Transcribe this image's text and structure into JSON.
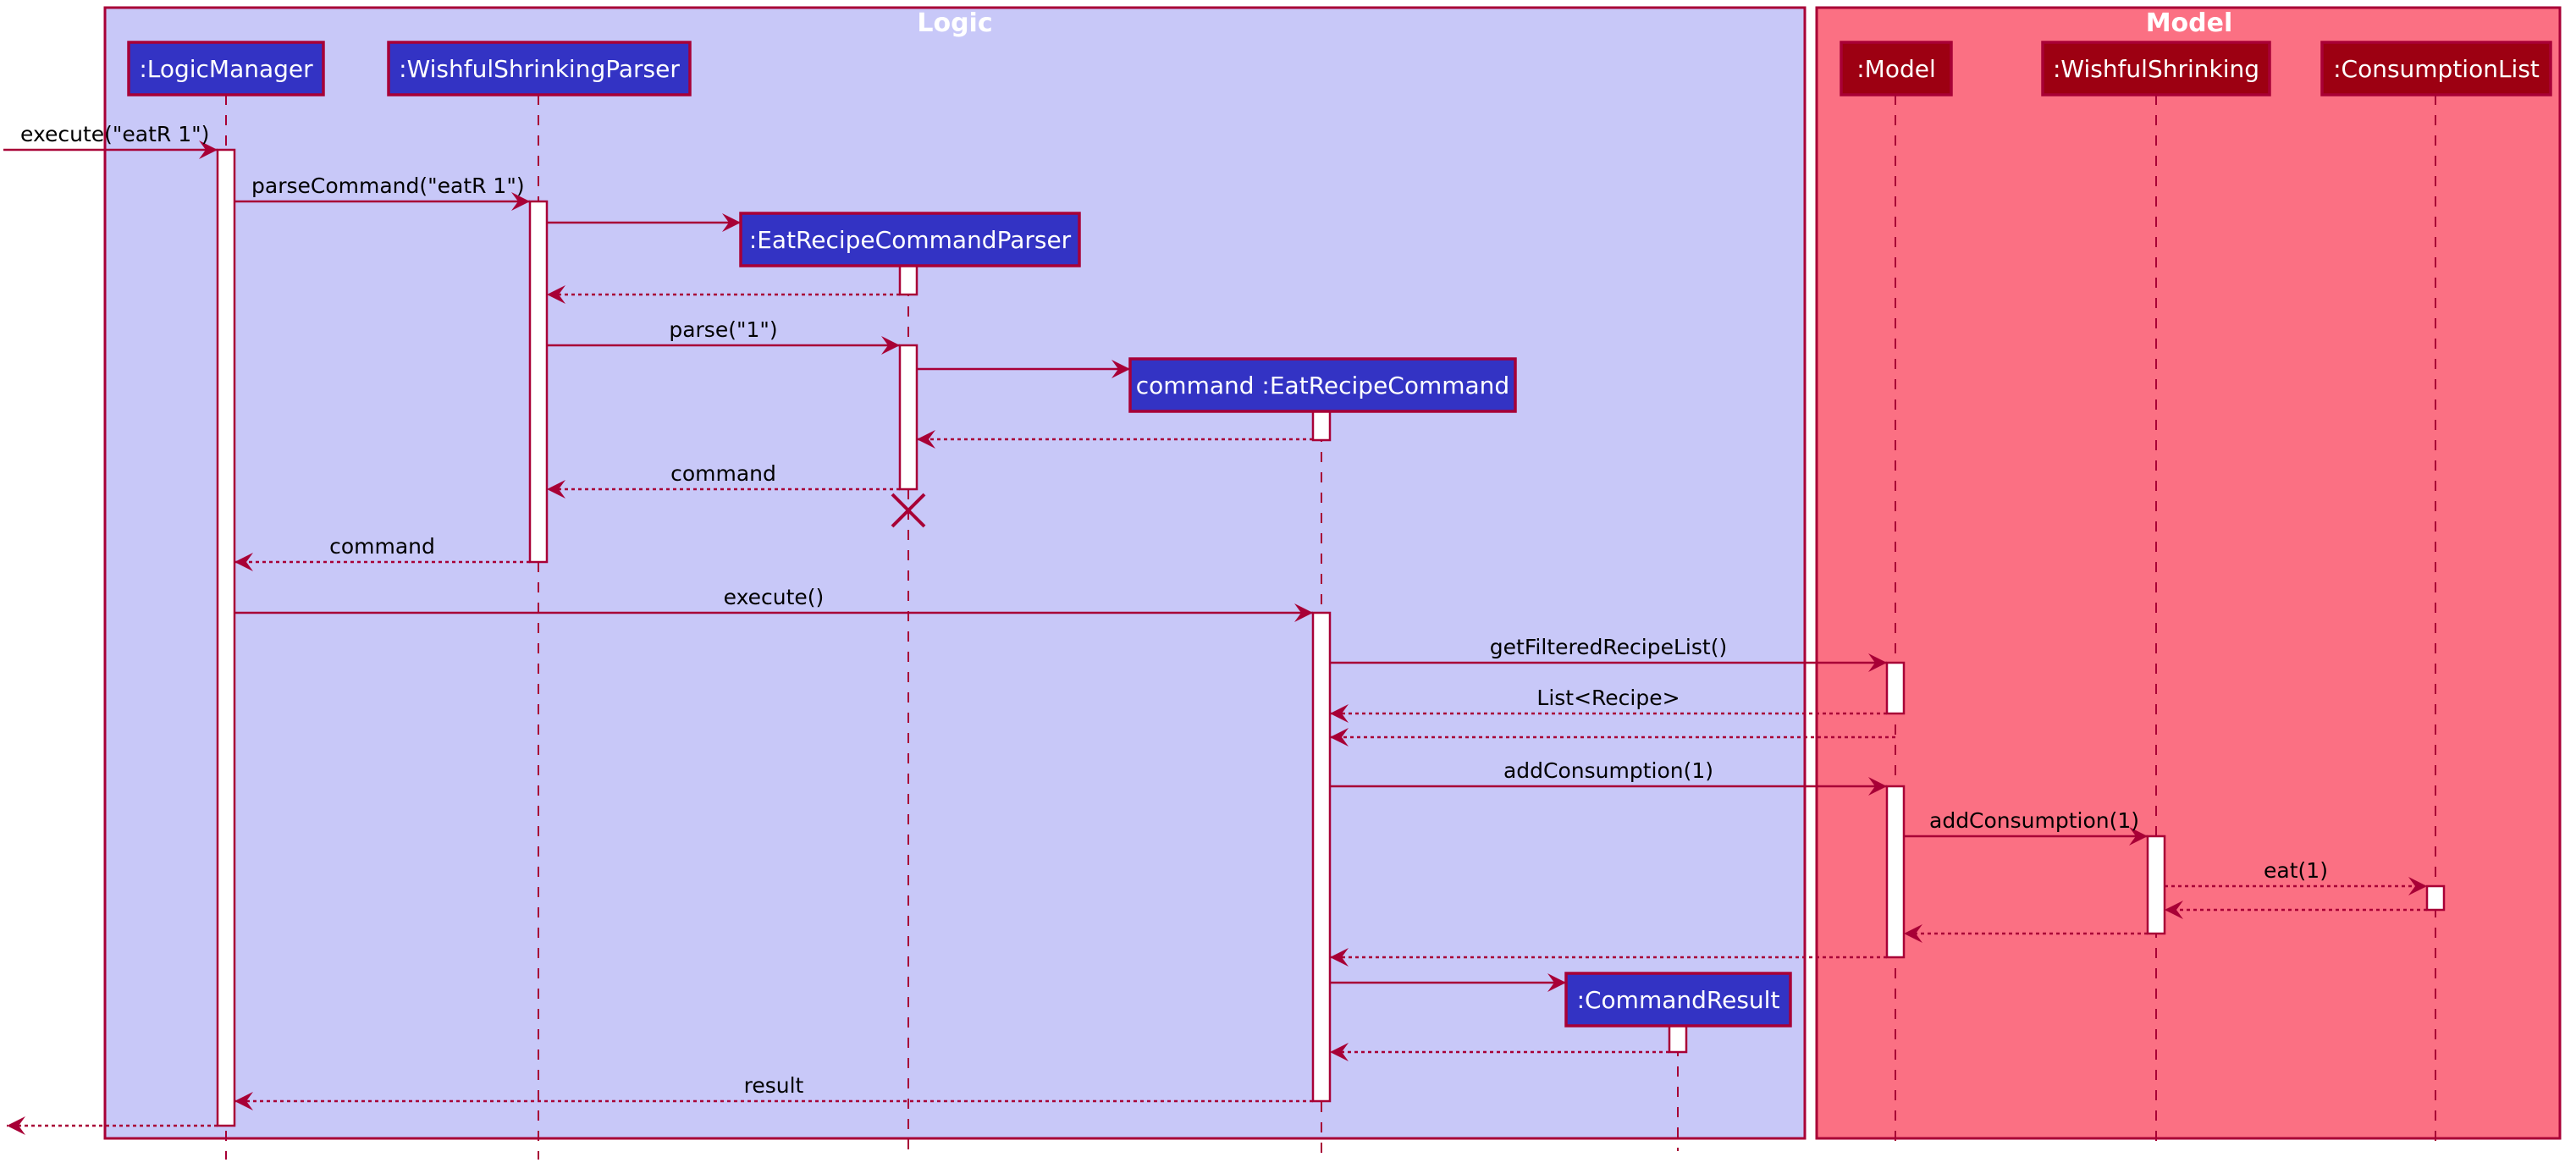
{
  "diagram": {
    "type": "sequence",
    "frames": [
      {
        "id": "logic",
        "title": "Logic",
        "fill": "#C8C8F8",
        "border": "#A80036"
      },
      {
        "id": "model",
        "title": "Model",
        "fill": "#FB7083",
        "border": "#A80036"
      }
    ],
    "participants": [
      {
        "id": "logicManager",
        "label": ":LogicManager",
        "frame": "logic",
        "fill": "#3333C4"
      },
      {
        "id": "parser",
        "label": ":WishfulShrinkingParser",
        "frame": "logic",
        "fill": "#3333C4"
      },
      {
        "id": "eatParser",
        "label": ":EatRecipeCommandParser",
        "frame": "logic",
        "fill": "#3333C4",
        "created": true,
        "destroyed": true
      },
      {
        "id": "command",
        "label": "command :EatRecipeCommand",
        "frame": "logic",
        "fill": "#3333C4",
        "created": true
      },
      {
        "id": "result",
        "label": ":CommandResult",
        "frame": "logic",
        "fill": "#3333C4",
        "created": true
      },
      {
        "id": "model",
        "label": ":Model",
        "frame": "model",
        "fill": "#9D0012"
      },
      {
        "id": "wishful",
        "label": ":WishfulShrinking",
        "frame": "model",
        "fill": "#9D0012"
      },
      {
        "id": "consumption",
        "label": ":ConsumptionList",
        "frame": "model",
        "fill": "#9D0012"
      }
    ],
    "messages": [
      {
        "from": "external",
        "to": "logicManager",
        "label": "execute(\"eatR 1\")",
        "kind": "call"
      },
      {
        "from": "logicManager",
        "to": "parser",
        "label": "parseCommand(\"eatR 1\")",
        "kind": "call"
      },
      {
        "from": "parser",
        "to": "eatParser",
        "label": "",
        "kind": "create"
      },
      {
        "from": "eatParser",
        "to": "parser",
        "label": "",
        "kind": "return"
      },
      {
        "from": "parser",
        "to": "eatParser",
        "label": "parse(\"1\")",
        "kind": "call"
      },
      {
        "from": "eatParser",
        "to": "command",
        "label": "",
        "kind": "create"
      },
      {
        "from": "command",
        "to": "eatParser",
        "label": "",
        "kind": "return"
      },
      {
        "from": "eatParser",
        "to": "parser",
        "label": "command",
        "kind": "return"
      },
      {
        "from": "parser",
        "to": "logicManager",
        "label": "command",
        "kind": "return"
      },
      {
        "from": "logicManager",
        "to": "command",
        "label": "execute()",
        "kind": "call"
      },
      {
        "from": "command",
        "to": "model",
        "label": "getFilteredRecipeList()",
        "kind": "call"
      },
      {
        "from": "model",
        "to": "command",
        "label": "List<Recipe>",
        "kind": "return"
      },
      {
        "from": "model",
        "to": "command",
        "label": "",
        "kind": "return"
      },
      {
        "from": "command",
        "to": "model",
        "label": "addConsumption(1)",
        "kind": "call"
      },
      {
        "from": "model",
        "to": "wishful",
        "label": "addConsumption(1)",
        "kind": "call"
      },
      {
        "from": "wishful",
        "to": "consumption",
        "label": "eat(1)",
        "kind": "call-dotted"
      },
      {
        "from": "consumption",
        "to": "wishful",
        "label": "",
        "kind": "return"
      },
      {
        "from": "wishful",
        "to": "model",
        "label": "",
        "kind": "return"
      },
      {
        "from": "model",
        "to": "command",
        "label": "",
        "kind": "return"
      },
      {
        "from": "command",
        "to": "result",
        "label": "",
        "kind": "create"
      },
      {
        "from": "result",
        "to": "command",
        "label": "",
        "kind": "return"
      },
      {
        "from": "command",
        "to": "logicManager",
        "label": "result",
        "kind": "return"
      },
      {
        "from": "logicManager",
        "to": "external",
        "label": "",
        "kind": "return"
      }
    ]
  }
}
